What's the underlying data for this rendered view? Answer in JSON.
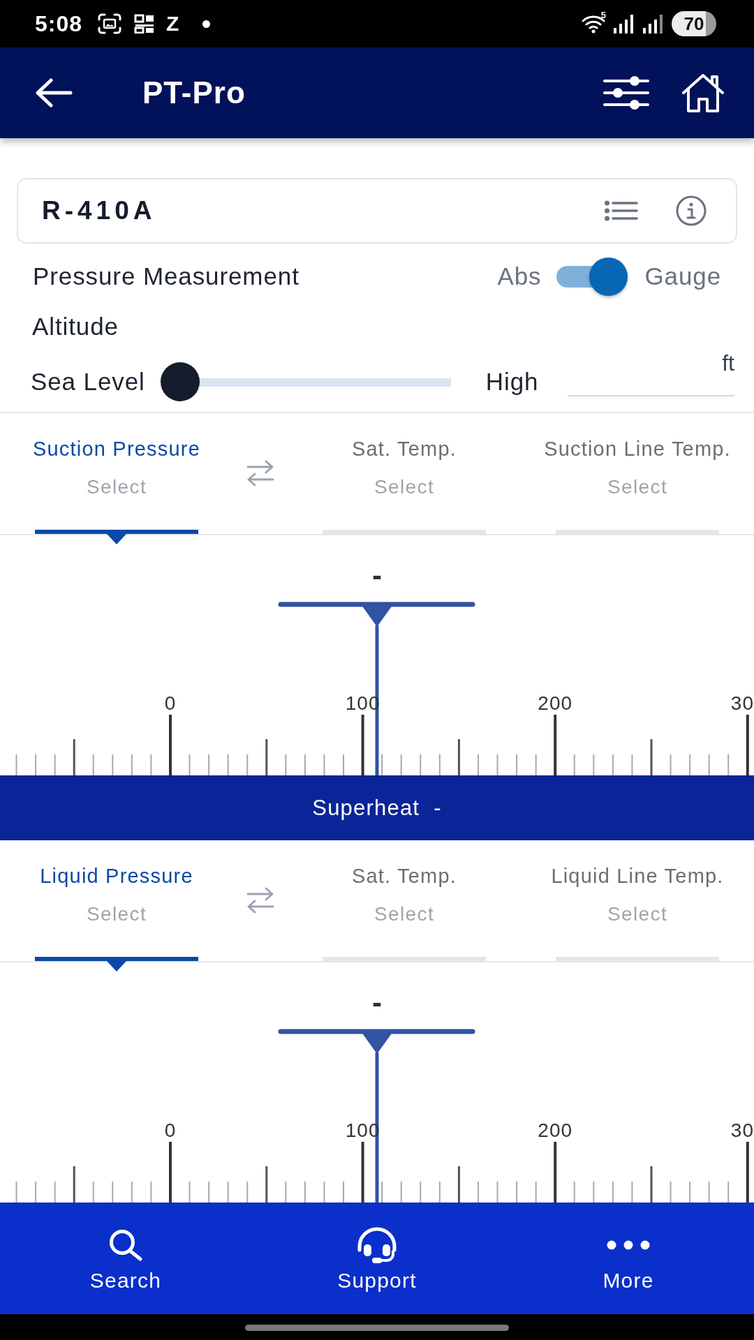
{
  "status_bar": {
    "time": "5:08",
    "notification_glyph": "Z",
    "network_badge": "5",
    "battery": "70"
  },
  "header": {
    "title": "PT-Pro"
  },
  "refrigerant": {
    "name": "R-410A"
  },
  "pressure_measurement": {
    "label": "Pressure Measurement",
    "off_label": "Abs",
    "on_label": "Gauge",
    "on": true
  },
  "altitude": {
    "label": "Altitude",
    "min_label": "Sea Level",
    "max_label": "High",
    "level": 0,
    "unit": "ft"
  },
  "sections": [
    {
      "tabs": [
        {
          "label": "Suction Pressure",
          "value": "Select",
          "selected": true
        },
        {
          "label": "Sat. Temp.",
          "value": "Select",
          "selected": false
        },
        {
          "label": "Suction Line Temp.",
          "value": "Select",
          "selected": false
        }
      ],
      "reading": "-",
      "scale_labels": [
        "0",
        "100",
        "200",
        "30"
      ],
      "result": {
        "label": "Superheat",
        "value": "-"
      }
    },
    {
      "tabs": [
        {
          "label": "Liquid Pressure",
          "value": "Select",
          "selected": true
        },
        {
          "label": "Sat. Temp.",
          "value": "Select",
          "selected": false
        },
        {
          "label": "Liquid Line Temp.",
          "value": "Select",
          "selected": false
        }
      ],
      "reading": "-",
      "scale_labels": [
        "0",
        "100",
        "200",
        "30"
      ]
    }
  ],
  "bottom_nav": [
    {
      "kind": "search",
      "label": "Search"
    },
    {
      "kind": "support",
      "label": "Support"
    },
    {
      "kind": "more",
      "label": "More"
    }
  ]
}
